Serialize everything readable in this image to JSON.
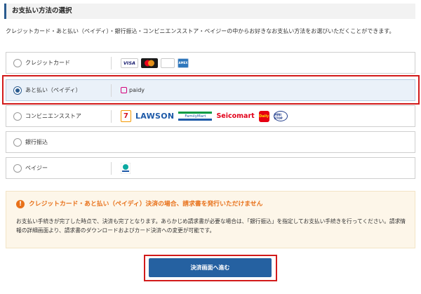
{
  "section": {
    "title": "お支払い方法の選択"
  },
  "intro": "クレジットカード・あと払い（ペイディ）・銀行振込・コンビニエンスストア・ペイジーの中からお好きなお支払い方法をお選びいただくことができます。",
  "options": [
    {
      "label": "クレジットカード",
      "selected": false,
      "logos": [
        "VISA",
        "mastercard-logo",
        "JCB",
        "AMERICAN EXPRESS"
      ]
    },
    {
      "label": "あと払い（ペイディ）",
      "selected": true,
      "logo_text": "paidy"
    },
    {
      "label": "コンビニエンスストア",
      "selected": false,
      "logos": [
        "7",
        "LAWSON",
        "FamilyMart",
        "Seicomart",
        "Daily",
        "MINI STOP"
      ]
    },
    {
      "label": "銀行振込",
      "selected": false
    },
    {
      "label": "ペイジー",
      "selected": false,
      "logo_text": "Pay-easy"
    }
  ],
  "notice": {
    "icon": "!",
    "title": "クレジットカード・あと払い（ペイディ）決済の場合、請求書を発行いただけません",
    "body": "お支払い手続きが完了した時点で、決済も完了となります。あらかじめ請求書が必要な場合は、「銀行振込」を指定してお支払い手続きを行ってください。請求情報の詳細画面より、請求書のダウンロードおよびカード決済への変更が可能です。"
  },
  "submit": {
    "label": "決済画面へ進む"
  },
  "colors": {
    "accent": "#2561a1",
    "highlight": "#d21a1a",
    "notice": "#e8711a"
  }
}
